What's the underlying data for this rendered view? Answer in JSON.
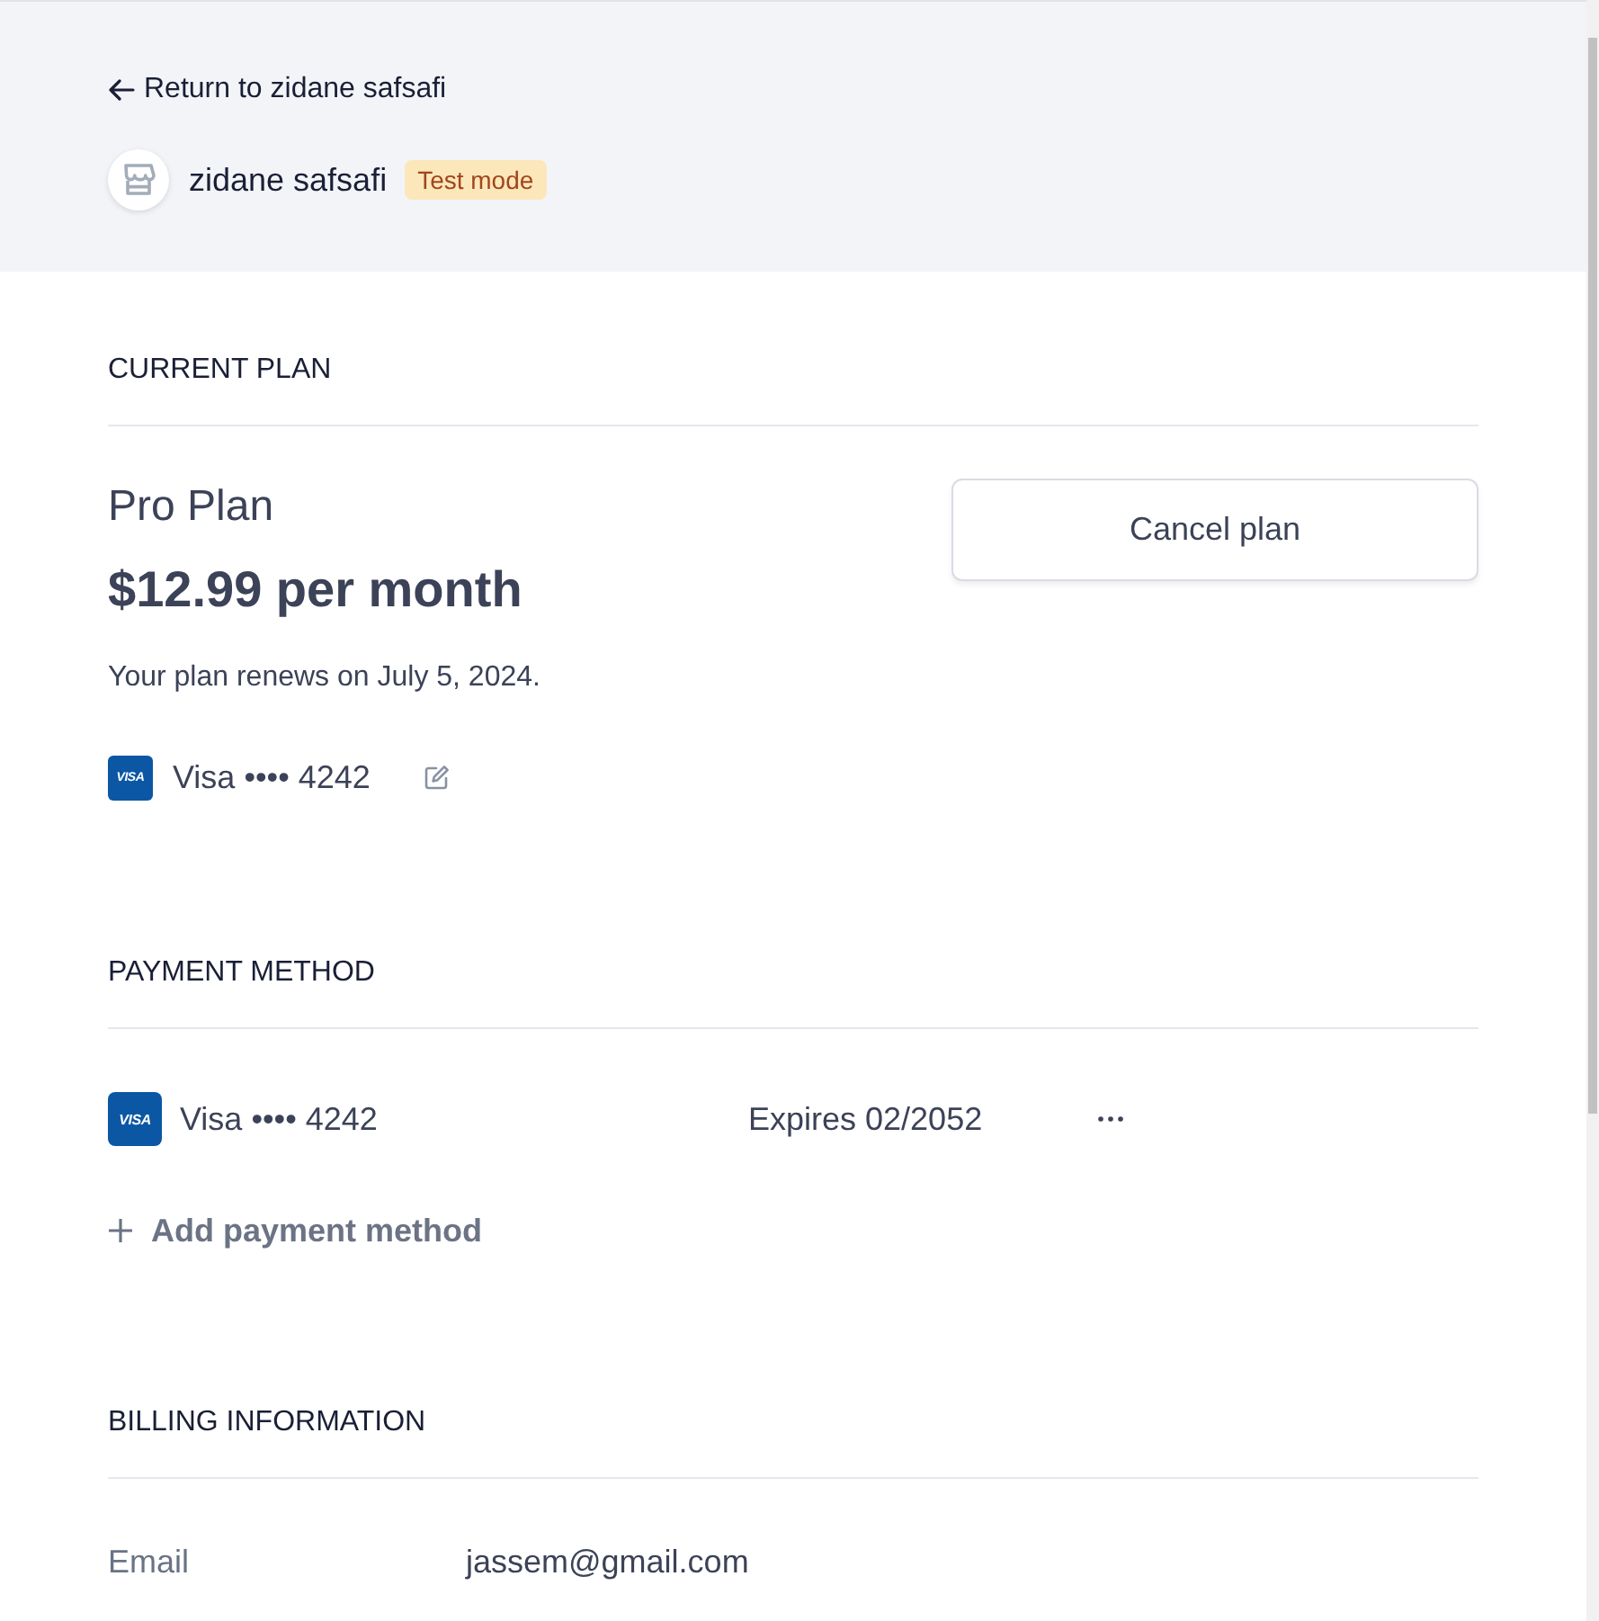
{
  "header": {
    "back_link": "Return to zidane safsafi",
    "account_name": "zidane safsafi",
    "badge": "Test mode"
  },
  "sections": [
    {
      "kind": "plan",
      "heading": "CURRENT PLAN",
      "plan_name": "Pro Plan",
      "price": "$12.99 per month",
      "renewal": "Your plan renews on July 5, 2024.",
      "card": {
        "logo": "VISA",
        "label": "Visa •••• 4242"
      },
      "cancel_button": "Cancel plan"
    },
    {
      "kind": "payment_methods",
      "heading": "PAYMENT METHOD",
      "methods": [
        {
          "logo": "VISA",
          "label": "Visa •••• 4242",
          "expires": "Expires 02/2052"
        }
      ],
      "add_button": "Add payment method"
    },
    {
      "kind": "billing",
      "heading": "BILLING INFORMATION",
      "fields": [
        {
          "label": "Email",
          "value": "jassem@gmail.com"
        }
      ]
    }
  ]
}
